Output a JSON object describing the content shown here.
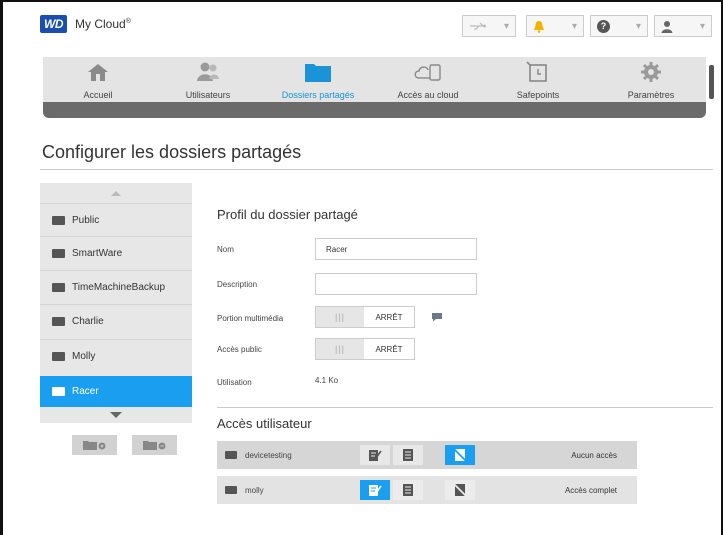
{
  "app": {
    "logo": "WD",
    "brand": "My Cloud",
    "brand_mark": "®"
  },
  "topbar": {
    "usb_caret": "▾",
    "alert_caret": "▾",
    "help_glyph": "?",
    "help_caret": "▾",
    "user_caret": "▾"
  },
  "nav": {
    "items": [
      {
        "label": "Accueil",
        "icon": "home-icon"
      },
      {
        "label": "Utilisateurs",
        "icon": "users-icon"
      },
      {
        "label": "Dossiers partagés",
        "icon": "folder-icon",
        "active": true
      },
      {
        "label": "Accès au cloud",
        "icon": "cloud-device-icon"
      },
      {
        "label": "Safepoints",
        "icon": "safepoint-icon"
      },
      {
        "label": "Paramètres",
        "icon": "gear-icon"
      }
    ]
  },
  "page": {
    "title": "Configurer les dossiers partagés"
  },
  "shares": {
    "items": [
      {
        "label": "Public"
      },
      {
        "label": "SmartWare"
      },
      {
        "label": "TimeMachineBackup"
      },
      {
        "label": "Charlie"
      },
      {
        "label": "Molly"
      },
      {
        "label": "Racer",
        "selected": true
      }
    ]
  },
  "profile": {
    "title": "Profil du dossier partagé",
    "name_label": "Nom",
    "name_value": "Racer",
    "description_label": "Description",
    "description_value": "",
    "media_label": "Portion multimédia",
    "media_state": "ARRÊT",
    "public_label": "Accès public",
    "public_state": "ARRÊT",
    "usage_label": "Utilisation",
    "usage_value": "4.1 Ko",
    "toggle_knob": "|||"
  },
  "user_access": {
    "title": "Accès utilisateur",
    "users": [
      {
        "name": "devicetesting",
        "state": "Aucun accès",
        "selected_permission": "none"
      },
      {
        "name": "molly",
        "state": "Accès complet",
        "selected_permission": "full"
      }
    ]
  },
  "colors": {
    "accent": "#1a9ff0",
    "nav_bg": "#e4e4e4",
    "nav_bar": "#6b6b6b",
    "logo_bg": "#1a4fb0"
  }
}
